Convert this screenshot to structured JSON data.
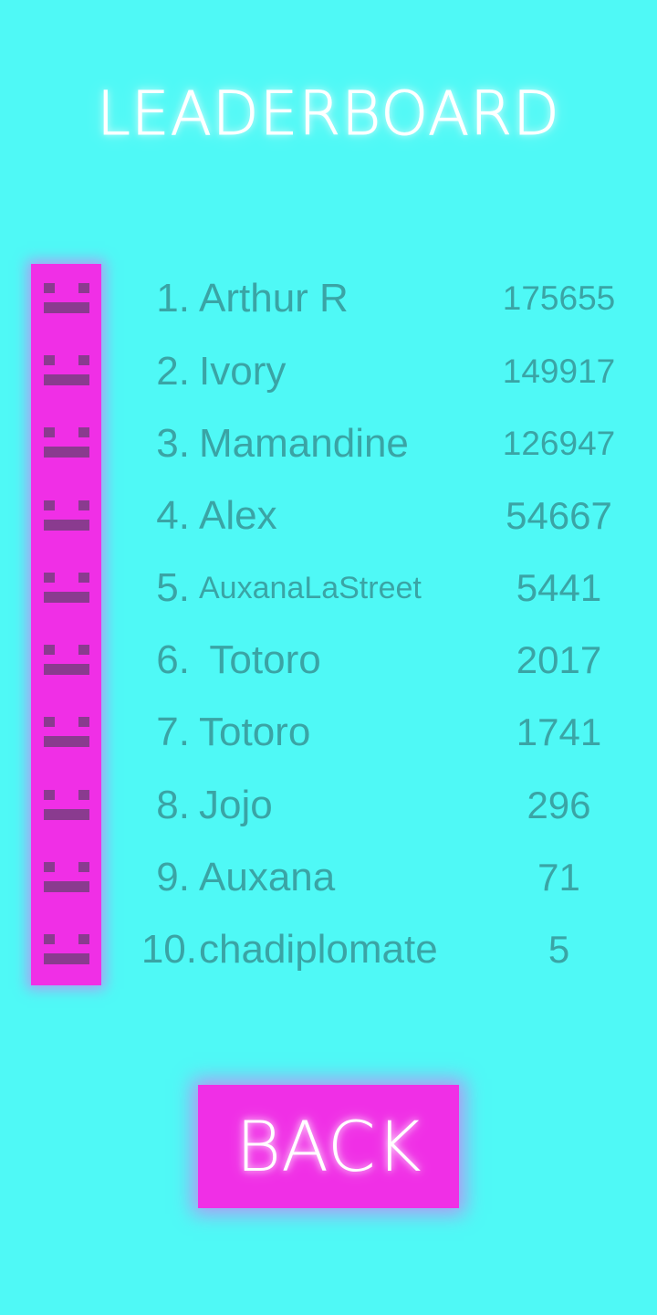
{
  "title": "LEADERBOARD",
  "entries": [
    {
      "rank": "1.",
      "name": "Arthur R",
      "score": "175655"
    },
    {
      "rank": "2.",
      "name": "Ivory",
      "score": "149917"
    },
    {
      "rank": "3.",
      "name": "Mamandine",
      "score": "126947"
    },
    {
      "rank": "4.",
      "name": "Alex",
      "score": "54667"
    },
    {
      "rank": "5.",
      "name": "AuxanaLaStreet",
      "score": "5441"
    },
    {
      "rank": "6.",
      "name": " Totoro",
      "score": "2017"
    },
    {
      "rank": "7.",
      "name": "Totoro",
      "score": "1741"
    },
    {
      "rank": "8.",
      "name": "Jojo",
      "score": "296"
    },
    {
      "rank": "9.",
      "name": "Auxana",
      "score": "71"
    },
    {
      "rank": "10.",
      "name": "chadiplomate",
      "score": "5"
    }
  ],
  "back_button": {
    "label": "BACK"
  },
  "colors": {
    "background": "#4ff9f6",
    "accent": "#f02fe6",
    "text": "#3aa4a5",
    "face": "#8a3b8f"
  }
}
